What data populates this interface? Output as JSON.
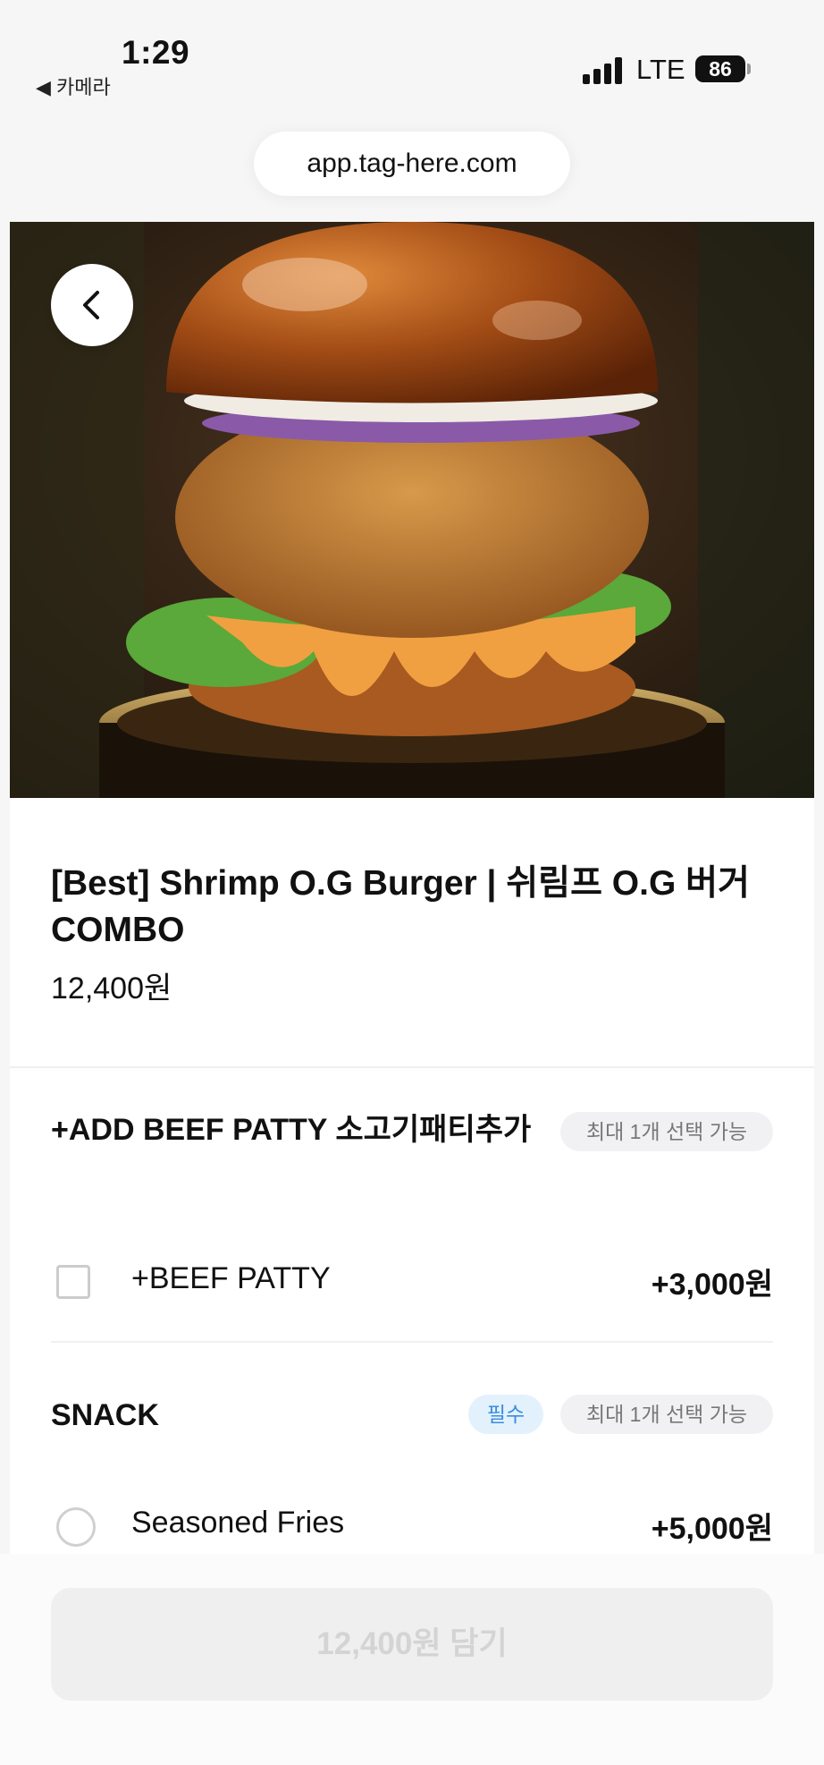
{
  "status_bar": {
    "time": "1:29",
    "back_app": "◀ 카메라",
    "network": "LTE",
    "battery": "86"
  },
  "browser": {
    "url": "app.tag-here.com"
  },
  "hero": {
    "image_alt": "burger photo",
    "back_icon": "chevron-left-icon"
  },
  "product": {
    "title": "[Best] Shrimp O.G Burger | 쉬림프 O.G 버거 COMBO",
    "price": "12,400원"
  },
  "option_groups": [
    {
      "title": "+ADD BEEF PATTY 소고기패티추가",
      "required": false,
      "limit_chip": "최대 1개 선택 가능",
      "options": [
        {
          "label": "+BEEF PATTY",
          "price": "+3,000원",
          "control": "checkbox",
          "checked": false
        }
      ]
    },
    {
      "title": "SNACK",
      "required": true,
      "required_chip": "필수",
      "limit_chip": "최대 1개 선택 가능",
      "options": [
        {
          "label": "Seasoned Fries",
          "price": "+5,000원",
          "control": "radio",
          "checked": false
        }
      ]
    }
  ],
  "cta": {
    "label": "12,400원 담기",
    "enabled": false
  },
  "colors": {
    "required_chip_bg": "#e3f1fd",
    "required_chip_text": "#3a8de0",
    "cta_disabled_bg": "#efefef",
    "cta_disabled_text": "#d4d4d4"
  }
}
